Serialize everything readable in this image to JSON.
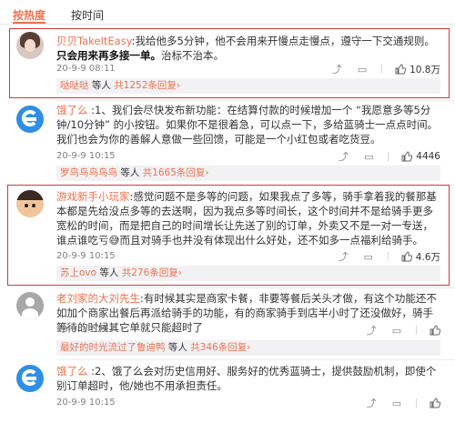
{
  "tabs": {
    "hot": "按热度",
    "time": "按时间"
  },
  "comments": [
    {
      "user": "贝贝TakeItEasy",
      "text_a": ":我给他多5分钟，他不会用来开慢点走慢点，遵守一下交通规则。",
      "text_b": "只会用来再多接一单。",
      "text_c": "治标不治本。",
      "time": "20-9-9 08:11",
      "likes": "10.8万",
      "reply_user": "哒哒哒",
      "reply_text": " 等人 ",
      "reply_count": "共1252条回复",
      "reply_arrow": "›"
    },
    {
      "user": "饿了么",
      "text": " :1、我们会尽快发布新功能：在结算付款的时候增加一个 “我愿意多等5分钟/10分钟” 的小按钮。如果你不是很着急，可以点一下，多给蓝骑士一点点时间。我们也会为你的善解人意做一些回馈，可能是一个小红包或者吃货豆。",
      "time": "20-9-9 10:15",
      "likes": "4446",
      "reply_user": "罗鸟鸟鸟鸟鸟",
      "reply_text": " 等人 ",
      "reply_count": "共1665条回复",
      "reply_arrow": "›"
    },
    {
      "user": "游戏新手小玩家",
      "text": ":感觉问题不是多等的问题，如果我点了多等，骑手拿着我的餐那基本都是先给没点多等的去送啊，因为我点多等时间长，这个时间并不是给骑手更多宽松的时间，而是把自己的时间增长让先送了别的订单，外卖又不是一对一专送，谁点谁吃亏😅而且对骑手也并没有体现出什么好处，还不如多一点福利给骑手。",
      "time": "20-9-9 10:15",
      "likes": "4.6万",
      "reply_user": "苏上ovo",
      "reply_text": " 等人 ",
      "reply_count": "共276条回复",
      "reply_arrow": "›"
    },
    {
      "user": "老刘家的大刘先生",
      "text": ":有时候其实是商家卡餐，非要等餐后关头才做，有这个功能还不如加个商家出餐后再派给骑手的功能，有的商家骑手到店半小时了还没做好，骑手等待的时候其它单就只能超时了",
      "time": "20-9-9 10:17",
      "likes": "",
      "reply_user": "最好的时光流过了鲁迪鸭",
      "reply_text": " 等人 ",
      "reply_count": "共346条回复",
      "reply_arrow": "›"
    },
    {
      "user": "饿了么",
      "text": " :2、饿了么会对历史信用好、服务好的优秀蓝骑士，提供鼓励机制，即使个别订单超时，他/她也不用承担责任。",
      "time": "20-9-9 10:15",
      "likes": "",
      "reply_user": "",
      "reply_text": "",
      "reply_count": "",
      "reply_arrow": ""
    }
  ],
  "icons": [
    "share-icon",
    "comment-icon",
    "like-icon"
  ],
  "colors": {
    "accent": "#eb7350",
    "highlight_box": "#d23a3a",
    "reply_bg": "#f2f2f5"
  }
}
